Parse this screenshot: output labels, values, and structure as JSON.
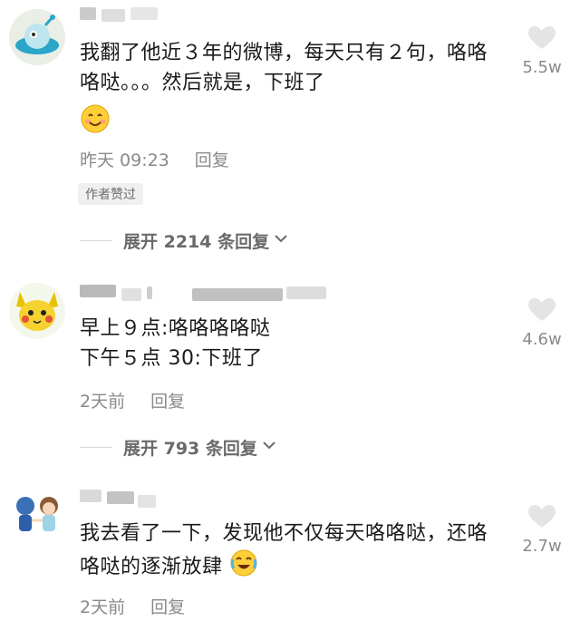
{
  "comments": [
    {
      "text": "我翻了他近３年的微博，每天只有２句，咯咯咯哒。。。然后就是，下班了",
      "time": "昨天 09:23",
      "reply_label": "回复",
      "badge": "作者赞过",
      "expand": "展开 2214 条回复",
      "likes": "5.5w",
      "emoji": "smiling-face-icon"
    },
    {
      "text_line1": "早上９点:咯咯咯咯哒",
      "text_line2": "下午５点 30:下班了",
      "time": "2天前",
      "reply_label": "回复",
      "expand": "展开 793 条回复",
      "likes": "4.6w"
    },
    {
      "text": "我去看了一下，发现他不仅每天咯咯哒，还咯咯哒的逐渐放肆",
      "time": "2天前",
      "reply_label": "回复",
      "likes": "2.7w",
      "emoji": "crying-laugh-face-icon"
    }
  ],
  "colors": {
    "text": "#1a1a1a",
    "meta": "#8a8a8a",
    "heart": "#e4e4e4"
  }
}
